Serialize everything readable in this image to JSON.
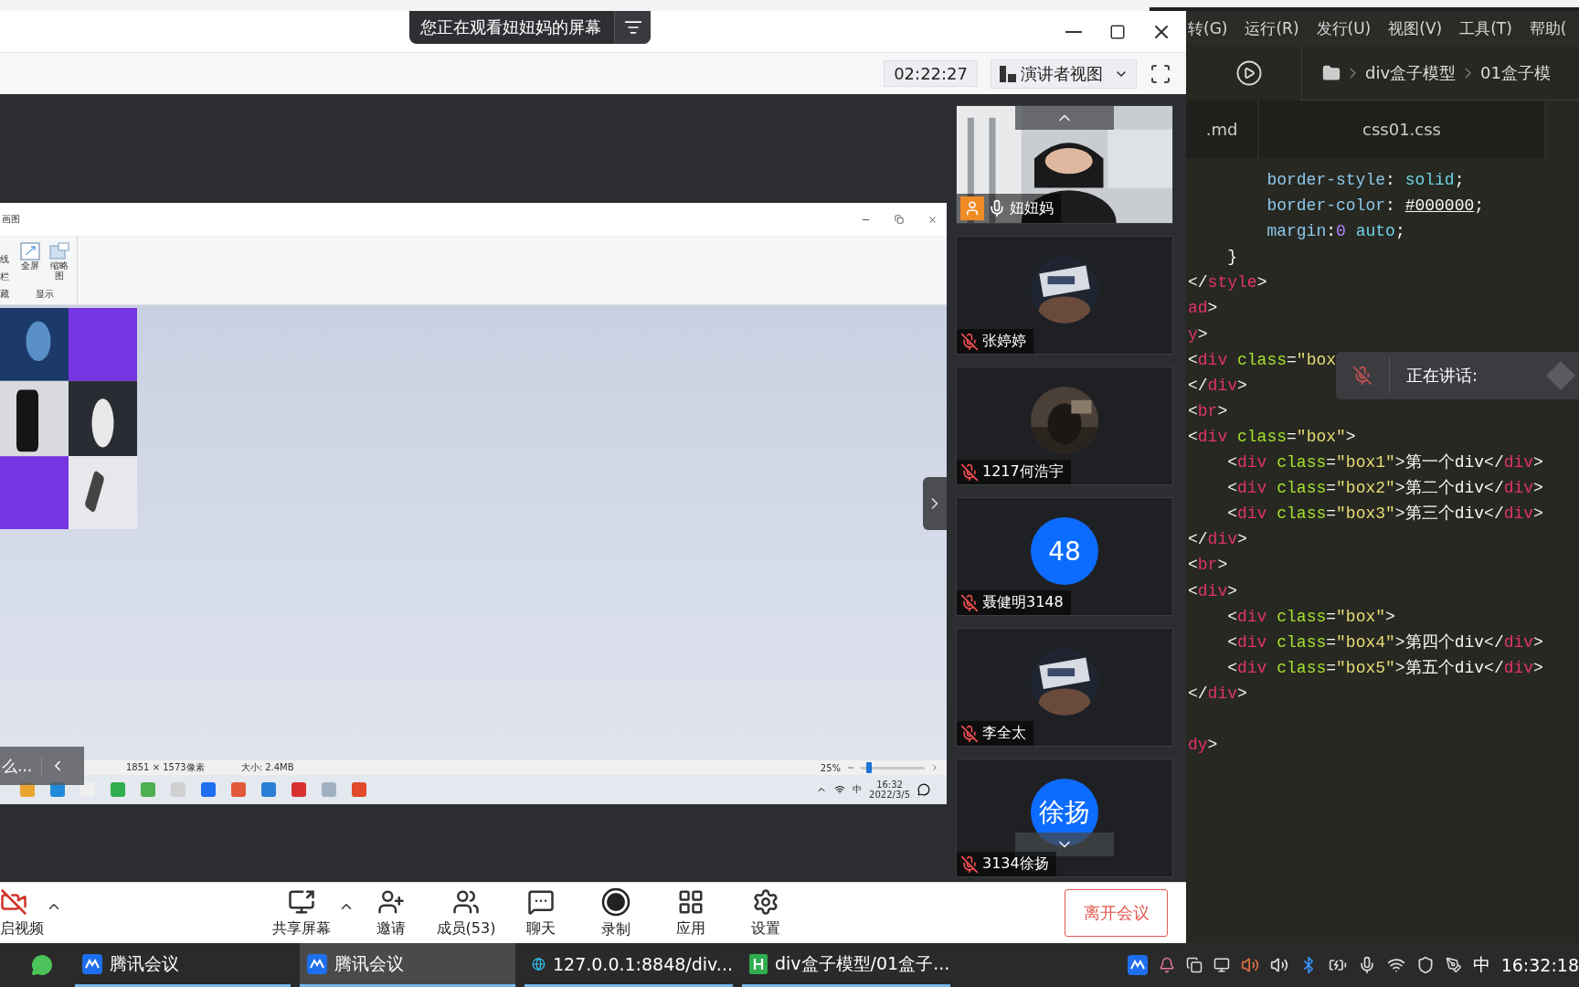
{
  "banner": {
    "text": "您正在观看妞妞妈的屏幕"
  },
  "meeting_toolbar": {
    "time": "02:22:27",
    "view": "演讲者视图"
  },
  "shared_screen": {
    "paint": {
      "title": "画图",
      "ribbon_cut_labels": [
        "线",
        "栏"
      ],
      "ribbon_group_cut": "藏",
      "ribbon_buttons": [
        {
          "label": "全屏",
          "kind": "fullscreen"
        },
        {
          "label": "缩略图",
          "kind": "thumbnail"
        }
      ],
      "ribbon_group": "显示",
      "status": {
        "dimensions": "1851 × 1573像素",
        "size": "大小: 2.4MB",
        "zoom": "25%",
        "zoom_slider": {
          "level": 0.08
        }
      }
    },
    "overlay_text": "么...",
    "taskbar": {
      "ime": "中",
      "time": "16:32",
      "date": "2022/3/5"
    }
  },
  "participants": [
    {
      "name": "妞妞妈",
      "kind": "video",
      "host": true,
      "muted": false
    },
    {
      "name": "张婷婷",
      "host": false,
      "muted": true
    },
    {
      "name": "1217何浩宇",
      "host": false,
      "muted": true
    },
    {
      "name": "聂健明3148",
      "kind": "initials",
      "initials": "48",
      "host": false,
      "muted": true
    },
    {
      "name": "李全太",
      "host": false,
      "muted": true
    },
    {
      "name": "3134徐扬",
      "kind": "initials",
      "initials": "徐扬",
      "host": false,
      "muted": true
    }
  ],
  "bottom_toolbar": [
    {
      "label": "启视频",
      "caret": true
    },
    {
      "label": "共享屏幕",
      "caret": true
    },
    {
      "label": "邀请",
      "caret": false
    },
    {
      "label": "成员(53)",
      "caret": false
    },
    {
      "label": "聊天",
      "caret": false
    },
    {
      "label": "录制",
      "caret": false
    },
    {
      "label": "应用",
      "caret": false
    },
    {
      "label": "设置",
      "caret": false
    }
  ],
  "leave_button": "离开会议",
  "editor": {
    "menu": [
      "转(G)",
      "运行(R)",
      "发行(U)",
      "视图(V)",
      "工具(T)",
      "帮助("
    ],
    "breadcrumb": [
      "div盒子模型",
      "01盒子模"
    ],
    "tabs": [
      ".md",
      "css01.css"
    ],
    "code_lines": [
      {
        "kind": "deep",
        "text": "border-style: solid;"
      },
      {
        "kind": "deep",
        "text": "border-color: #000000;"
      },
      {
        "kind": "deep",
        "text": "margin:0 auto;"
      },
      {
        "kind": "nested",
        "text": "}"
      },
      {
        "kind": "top",
        "text": "</style>"
      },
      {
        "kind": "top",
        "text": "ad>"
      },
      {
        "kind": "top",
        "text": "y>"
      },
      {
        "kind": "top",
        "text": "<div class=\"box"
      },
      {
        "kind": "top",
        "text": "</div>"
      },
      {
        "kind": "top",
        "text": "<br>"
      },
      {
        "kind": "top",
        "text": "<div class=\"box\">"
      },
      {
        "kind": "nested",
        "text": "<div class=\"box1\">第一个div</div>"
      },
      {
        "kind": "nested",
        "text": "<div class=\"box2\">第二个div</div>"
      },
      {
        "kind": "nested",
        "text": "<div class=\"box3\">第三个div</div>"
      },
      {
        "kind": "top",
        "text": "</div>"
      },
      {
        "kind": "top",
        "text": "<br>"
      },
      {
        "kind": "top",
        "text": "<div>"
      },
      {
        "kind": "nested",
        "text": "<div class=\"box\">"
      },
      {
        "kind": "nested",
        "text": "<div class=\"box4\">第四个div</div>"
      },
      {
        "kind": "nested",
        "text": "<div class=\"box5\">第五个div</div>"
      },
      {
        "kind": "top",
        "text": "</div>"
      },
      {
        "kind": "top",
        "space_before": true,
        "text": "dy>"
      }
    ],
    "speaking": "正在讲话:"
  },
  "taskbar": {
    "apps": [
      {
        "label": "腾讯会议",
        "selected": false
      },
      {
        "label": "腾讯会议",
        "selected": true
      },
      {
        "label": "127.0.0.1:8848/div...",
        "selected": false
      },
      {
        "label": "div盒子模型/01盒子...",
        "selected": false
      }
    ],
    "ime": "中",
    "time": "16:32:18"
  }
}
